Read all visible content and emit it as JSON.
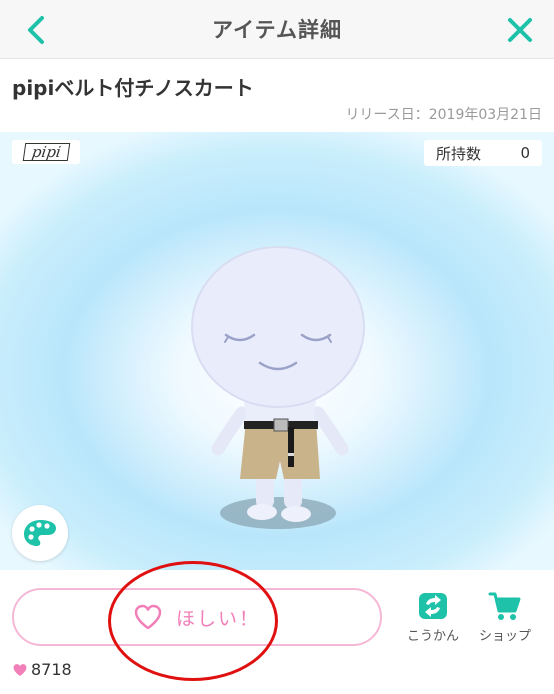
{
  "header": {
    "title": "アイテム詳細"
  },
  "item": {
    "name": "pipiベルト付チノスカート",
    "release_text": "リリース日：2019年03月21日"
  },
  "preview": {
    "brand_logo": "pipi",
    "owned_label": "所持数",
    "owned_count": "0",
    "icons": {
      "palette": "palette-icon"
    }
  },
  "actions": {
    "want_label": "ほしい！",
    "exchange_label": "こうかん",
    "shop_label": "ショップ"
  },
  "likes": {
    "count": "8718"
  },
  "colors": {
    "accent_teal": "#1ec2a8",
    "pink": "#f27fb8",
    "pink_border": "#f4b8d6",
    "annotation_red": "#e01010"
  }
}
